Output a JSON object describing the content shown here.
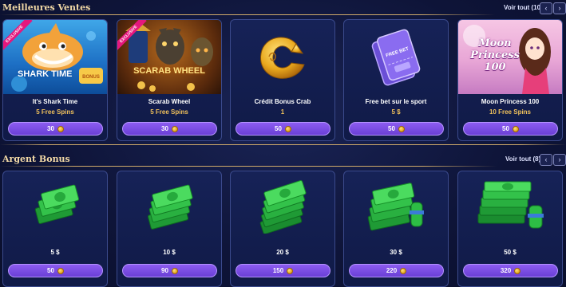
{
  "sections": [
    {
      "title": "Meilleures Ventes",
      "view_all": "Voir tout (10)",
      "items": [
        {
          "name": "It's Shark Time",
          "sub": "5 Free Spins",
          "price": "30",
          "icon": "shark-game-icon",
          "badge": "EXCLUSIVE",
          "art_text": "SHARK TIME"
        },
        {
          "name": "Scarab Wheel",
          "sub": "5 Free Spins",
          "price": "30",
          "icon": "scarab-game-icon",
          "badge": "EXCLUSIVE",
          "art_text": "SCARAB WHEEL"
        },
        {
          "name": "Crédit Bonus Crab",
          "sub": "1",
          "price": "50",
          "icon": "crab-claw-icon"
        },
        {
          "name": "Free bet sur le sport",
          "sub": "5 $",
          "price": "50",
          "icon": "ticket-icon",
          "art_text": "FREE BET"
        },
        {
          "name": "Moon Princess 100",
          "sub": "10 Free Spins",
          "price": "50",
          "icon": "princess-game-icon",
          "art_text": "Moon Princess 100"
        }
      ]
    },
    {
      "title": "Argent Bonus",
      "view_all": "Voir tout (8)",
      "items": [
        {
          "amount": "5 $",
          "price": "50",
          "icon": "cash-stack-icon"
        },
        {
          "amount": "10 $",
          "price": "90",
          "icon": "cash-stack-icon"
        },
        {
          "amount": "20 $",
          "price": "150",
          "icon": "cash-stack-icon"
        },
        {
          "amount": "30 $",
          "price": "220",
          "icon": "cash-stack-icon"
        },
        {
          "amount": "50 $",
          "price": "320",
          "icon": "cash-stack-icon"
        }
      ]
    }
  ],
  "nav": {
    "prev": "‹",
    "next": "›"
  }
}
